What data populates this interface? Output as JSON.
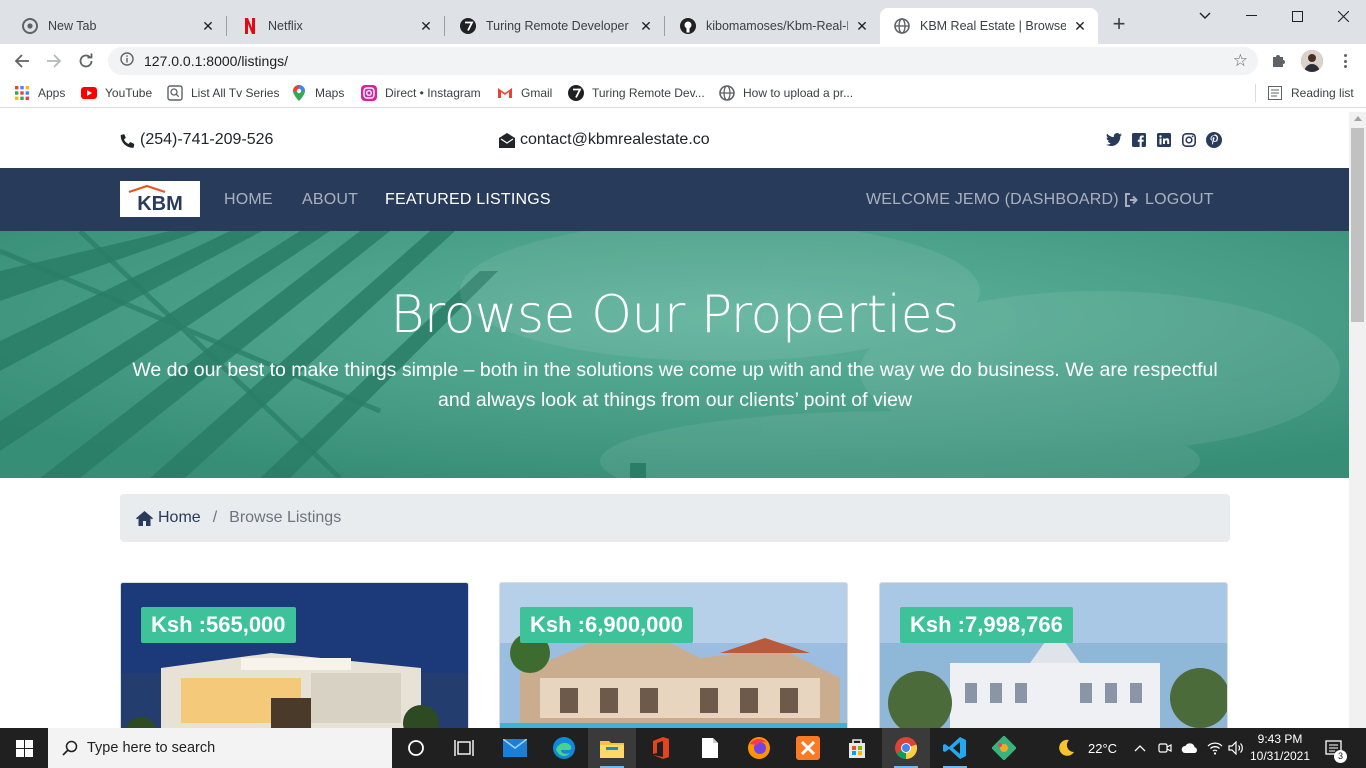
{
  "browser": {
    "tabs": [
      {
        "title": "New Tab",
        "icon": "chrome-icon",
        "active": false
      },
      {
        "title": "Netflix",
        "icon": "netflix-icon",
        "active": false
      },
      {
        "title": "Turing Remote Developer Jobs",
        "icon": "turing-icon",
        "active": false
      },
      {
        "title": "kibomamoses/Kbm-Real-Estate",
        "icon": "github-icon",
        "active": false
      },
      {
        "title": "KBM Real Estate | Browse Properties",
        "icon": "globe-icon",
        "active": true
      }
    ],
    "url_host": "127.0.0.1",
    "url_path": ":8000/listings/",
    "bookmarks": [
      {
        "label": "Apps",
        "icon": "apps-grid-icon"
      },
      {
        "label": "YouTube",
        "icon": "youtube-icon"
      },
      {
        "label": "List All Tv Series",
        "icon": "tv-icon"
      },
      {
        "label": "Maps",
        "icon": "maps-pin-icon"
      },
      {
        "label": "Direct • Instagram",
        "icon": "instagram-icon"
      },
      {
        "label": "Gmail",
        "icon": "gmail-icon"
      },
      {
        "label": "Turing Remote Dev...",
        "icon": "turing-icon"
      },
      {
        "label": "How to upload a pr...",
        "icon": "globe-icon"
      }
    ],
    "reading_list": "Reading list"
  },
  "site": {
    "phone": "(254)-741-209-526",
    "email": "contact@kbmrealestate.co",
    "logo_text": "KBM",
    "nav": {
      "home": "HOME",
      "about": "ABOUT",
      "featured": "FEATURED LISTINGS",
      "welcome": "WELCOME JEMO (DASHBOARD)",
      "logout": "LOGOUT"
    },
    "hero": {
      "title": "Browse Our Properties",
      "subtitle": "We do our best to make things simple – both in the solutions we come up with and the way we do business. We are respectful and always look at things from our clients’ point of view"
    },
    "breadcrumb": {
      "home": "Home",
      "current": "Browse Listings"
    },
    "listings": [
      {
        "price": "Ksh :565,000"
      },
      {
        "price": "Ksh :6,900,000"
      },
      {
        "price": "Ksh :7,998,766"
      }
    ]
  },
  "taskbar": {
    "search_placeholder": "Type here to search",
    "temperature": "22°C",
    "time": "9:43 PM",
    "date": "10/31/2021",
    "notifications": "3"
  },
  "colors": {
    "navbar": "#283b5b",
    "hero": "#3f9e85",
    "price_badge": "#3dc29a"
  }
}
